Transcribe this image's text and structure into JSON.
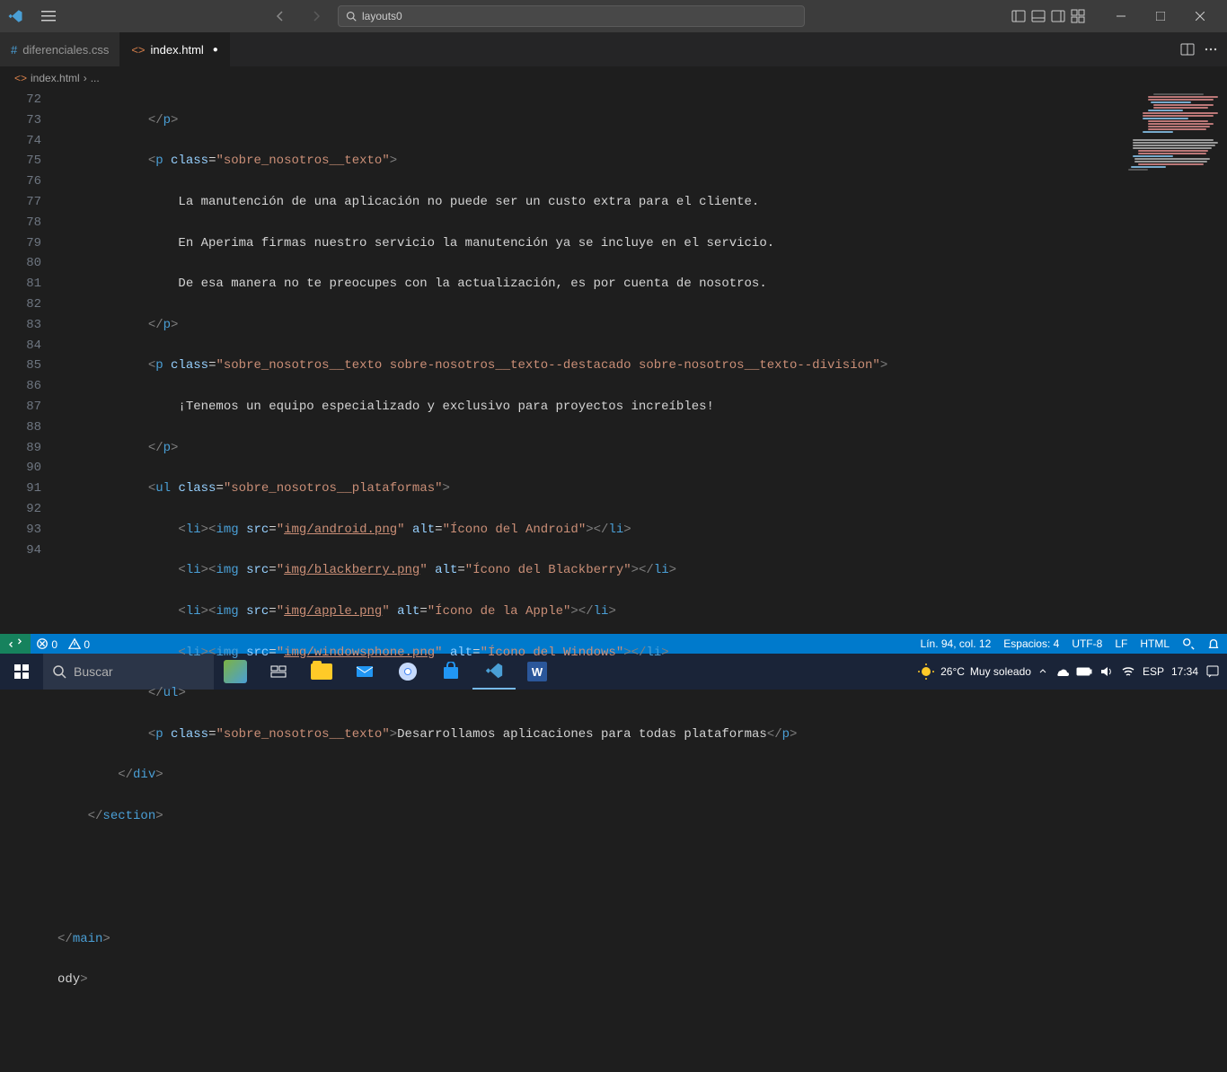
{
  "titlebar": {
    "search_text": "layouts0"
  },
  "tabs": [
    {
      "name": "diferenciales.css",
      "icon_class": "css-icon",
      "icon_glyph": "#"
    },
    {
      "name": "index.html",
      "icon_class": "html-icon",
      "icon_glyph": "<>"
    }
  ],
  "breadcrumb": {
    "file_icon": "<>",
    "file": "index.html",
    "sep": "›",
    "more": "..."
  },
  "line_numbers": [
    "72",
    "73",
    "74",
    "75",
    "76",
    "77",
    "78",
    "79",
    "80",
    "81",
    "82",
    "83",
    "84",
    "85",
    "86",
    "87",
    "88",
    "89",
    "90",
    "91",
    "92",
    "93",
    "94"
  ],
  "code": {
    "l72": {
      "close_tag": "p"
    },
    "l73": {
      "tag": "p",
      "attr": "class",
      "val": "sobre_nosotros__texto"
    },
    "l74": {
      "text": "La manutención de una aplicación no puede ser un custo extra para el cliente."
    },
    "l75": {
      "text": "En Aperima firmas nuestro servicio la manutención ya se incluye en el servicio."
    },
    "l76": {
      "text": "De esa manera no te preocupes con la actualización, es por cuenta de nosotros."
    },
    "l77": {
      "close_tag": "p"
    },
    "l78": {
      "tag": "p",
      "attr": "class",
      "val": "sobre_nosotros__texto sobre-nosotros__texto--destacado sobre-nosotros__texto--division"
    },
    "l79": {
      "text": "¡Tenemos un equipo especializado y exclusivo para proyectos increíbles!"
    },
    "l80": {
      "close_tag": "p"
    },
    "l81": {
      "tag": "ul",
      "attr": "class",
      "val": "sobre_nosotros__plataformas"
    },
    "l82": {
      "tag": "li",
      "img_tag": "img",
      "src_attr": "src",
      "src_val": "img/android.png",
      "alt_attr": "alt",
      "alt_val": "Ícono del Android"
    },
    "l83": {
      "tag": "li",
      "img_tag": "img",
      "src_attr": "src",
      "src_val": "img/blackberry.png",
      "alt_attr": "alt",
      "alt_val": "Ícono del Blackberry"
    },
    "l84": {
      "tag": "li",
      "img_tag": "img",
      "src_attr": "src",
      "src_val": "img/apple.png",
      "alt_attr": "alt",
      "alt_val": "Ícono de la Apple"
    },
    "l85": {
      "tag": "li",
      "img_tag": "img",
      "src_attr": "src",
      "src_val": "img/windowsphone.png",
      "alt_attr": "alt",
      "alt_val": "Ícono del Windows"
    },
    "l86": {
      "close_tag": "ul"
    },
    "l87": {
      "tag": "p",
      "attr": "class",
      "val": "sobre_nosotros__texto",
      "text": "Desarrollamos aplicaciones para todas plataformas",
      "close_tag": "p"
    },
    "l88": {
      "close_tag": "div"
    },
    "l89": {
      "close_tag": "section"
    },
    "l92": {
      "close_tag": "main"
    },
    "l93": {
      "text": "ody",
      "b": ">"
    }
  },
  "status": {
    "errors": "0",
    "warnings": "0",
    "position": "Lín. 94, col. 12",
    "spaces": "Espacios: 4",
    "encoding": "UTF-8",
    "eol": "LF",
    "language": "HTML"
  },
  "taskbar": {
    "search": "Buscar",
    "weather_temp": "26°C",
    "weather_text": "Muy soleado",
    "lang": "ESP",
    "time": "17:34"
  }
}
